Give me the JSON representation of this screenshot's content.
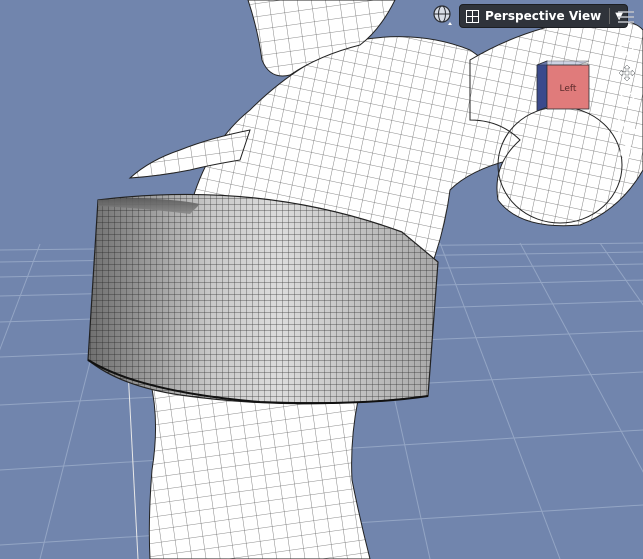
{
  "viewport": {
    "view_name": "Perspective View",
    "cube_face_label": "Left",
    "background_color": "#7185ad",
    "grid_color": "#9aabc9"
  },
  "icons": {
    "camera_select": "globe-icon",
    "view_menu_arrow": "chevron-down-icon",
    "options_menu": "hamburger-menu-icon",
    "nav_tools": [
      "pan-icon",
      "orbit-icon",
      "zoom-icon",
      "frame-icon",
      "rotate-icon"
    ]
  }
}
